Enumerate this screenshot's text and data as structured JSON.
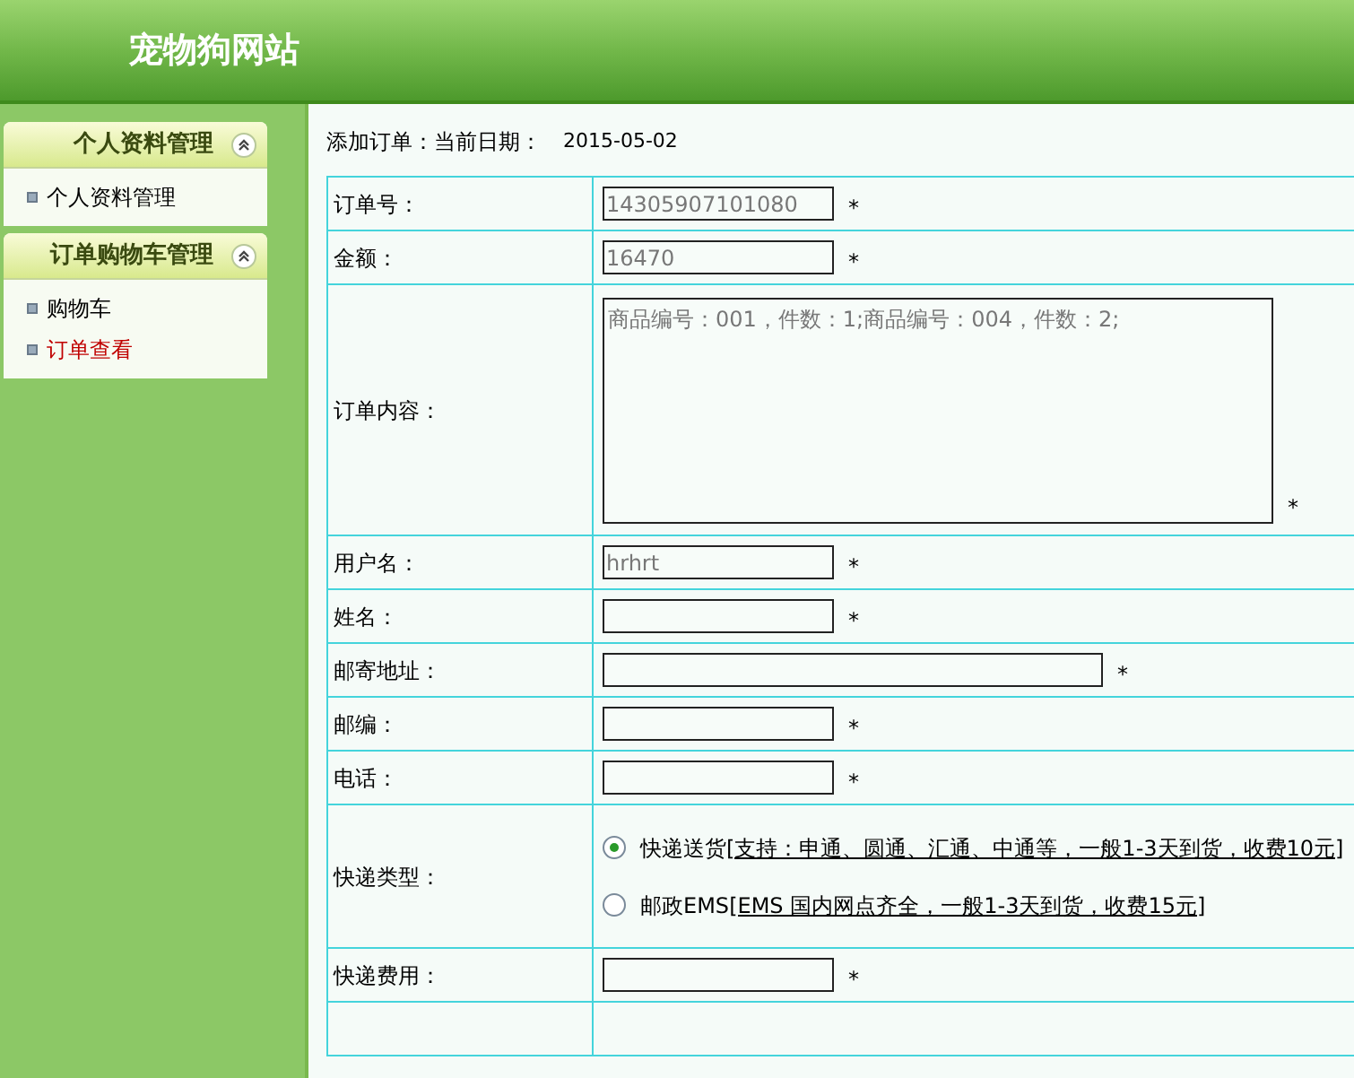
{
  "site_title": "宠物狗网站",
  "sidebar": [
    {
      "title": "个人资料管理",
      "expanded": true,
      "items": [
        {
          "label": "个人资料管理",
          "selected": false
        }
      ]
    },
    {
      "title": "订单购物车管理",
      "expanded": true,
      "items": [
        {
          "label": "购物车",
          "selected": false
        },
        {
          "label": "订单查看",
          "selected": true
        }
      ]
    }
  ],
  "heading": {
    "label": "添加订单：",
    "date_label": "当前日期：",
    "date": "2015-05-02"
  },
  "form": [
    {
      "kind": "input",
      "label": "订单号：",
      "value": "14305907101080",
      "wide": false,
      "required": "*"
    },
    {
      "kind": "input",
      "label": "金额：",
      "value": "16470",
      "wide": false,
      "required": "*"
    },
    {
      "kind": "textarea",
      "label": "订单内容：",
      "value": "商品编号：001，件数：1;商品编号：004，件数：2;",
      "required": "*"
    },
    {
      "kind": "input",
      "label": "用户名：",
      "value": "hrhrt",
      "wide": false,
      "required": "*"
    },
    {
      "kind": "input",
      "label": "姓名：",
      "wide": false,
      "required": "*"
    },
    {
      "kind": "input",
      "label": "邮寄地址：",
      "wide": true,
      "required": "*"
    },
    {
      "kind": "input",
      "label": "邮编：",
      "wide": false,
      "required": "*"
    },
    {
      "kind": "input",
      "label": "电话：",
      "wide": false,
      "required": "*"
    },
    {
      "kind": "radio",
      "label": "快递类型：",
      "options": [
        {
          "label": "快递送货",
          "detail": "[支持：申通、圆通、汇通、中通等，一般1-3天到货，收费10元]",
          "selected": true
        },
        {
          "label": "邮政EMS",
          "detail": "[EMS 国内网点齐全，一般1-3天到货，收费15元]",
          "selected": false
        }
      ]
    },
    {
      "kind": "input",
      "label": "快递费用：",
      "wide": false,
      "required": "*"
    },
    {
      "kind": "empty"
    }
  ]
}
